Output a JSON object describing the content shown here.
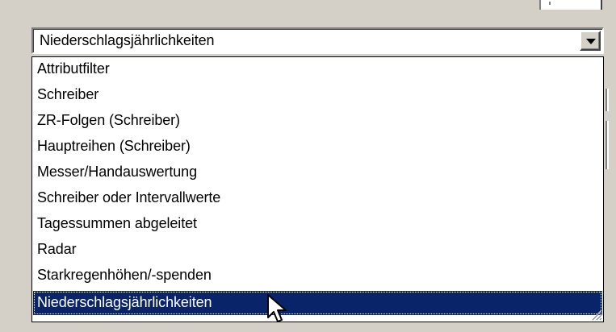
{
  "combo": {
    "value": "Niederschlagsjährlichkeiten",
    "button_icon": "dropdown-arrow-icon"
  },
  "dropdown": {
    "items": [
      {
        "label": "Attributfilter"
      },
      {
        "label": "Schreiber"
      },
      {
        "label": "ZR-Folgen (Schreiber)"
      },
      {
        "label": "Hauptreihen (Schreiber)"
      },
      {
        "label": "Messer/Handauswertung"
      },
      {
        "label": "Schreiber oder Intervallwerte"
      },
      {
        "label": "Tagessummen abgeleitet"
      },
      {
        "label": "Radar"
      },
      {
        "label": "Starkregenhöhen/-spenden"
      },
      {
        "label": "Niederschlagsjährlichkeiten"
      }
    ],
    "selected_index": 9
  },
  "cursor": {
    "icon": "mouse-pointer-icon"
  },
  "grip": {
    "icon": "resize-grip-icon"
  },
  "colors": {
    "selection": "#0a246a",
    "face": "#d4d0c8"
  }
}
